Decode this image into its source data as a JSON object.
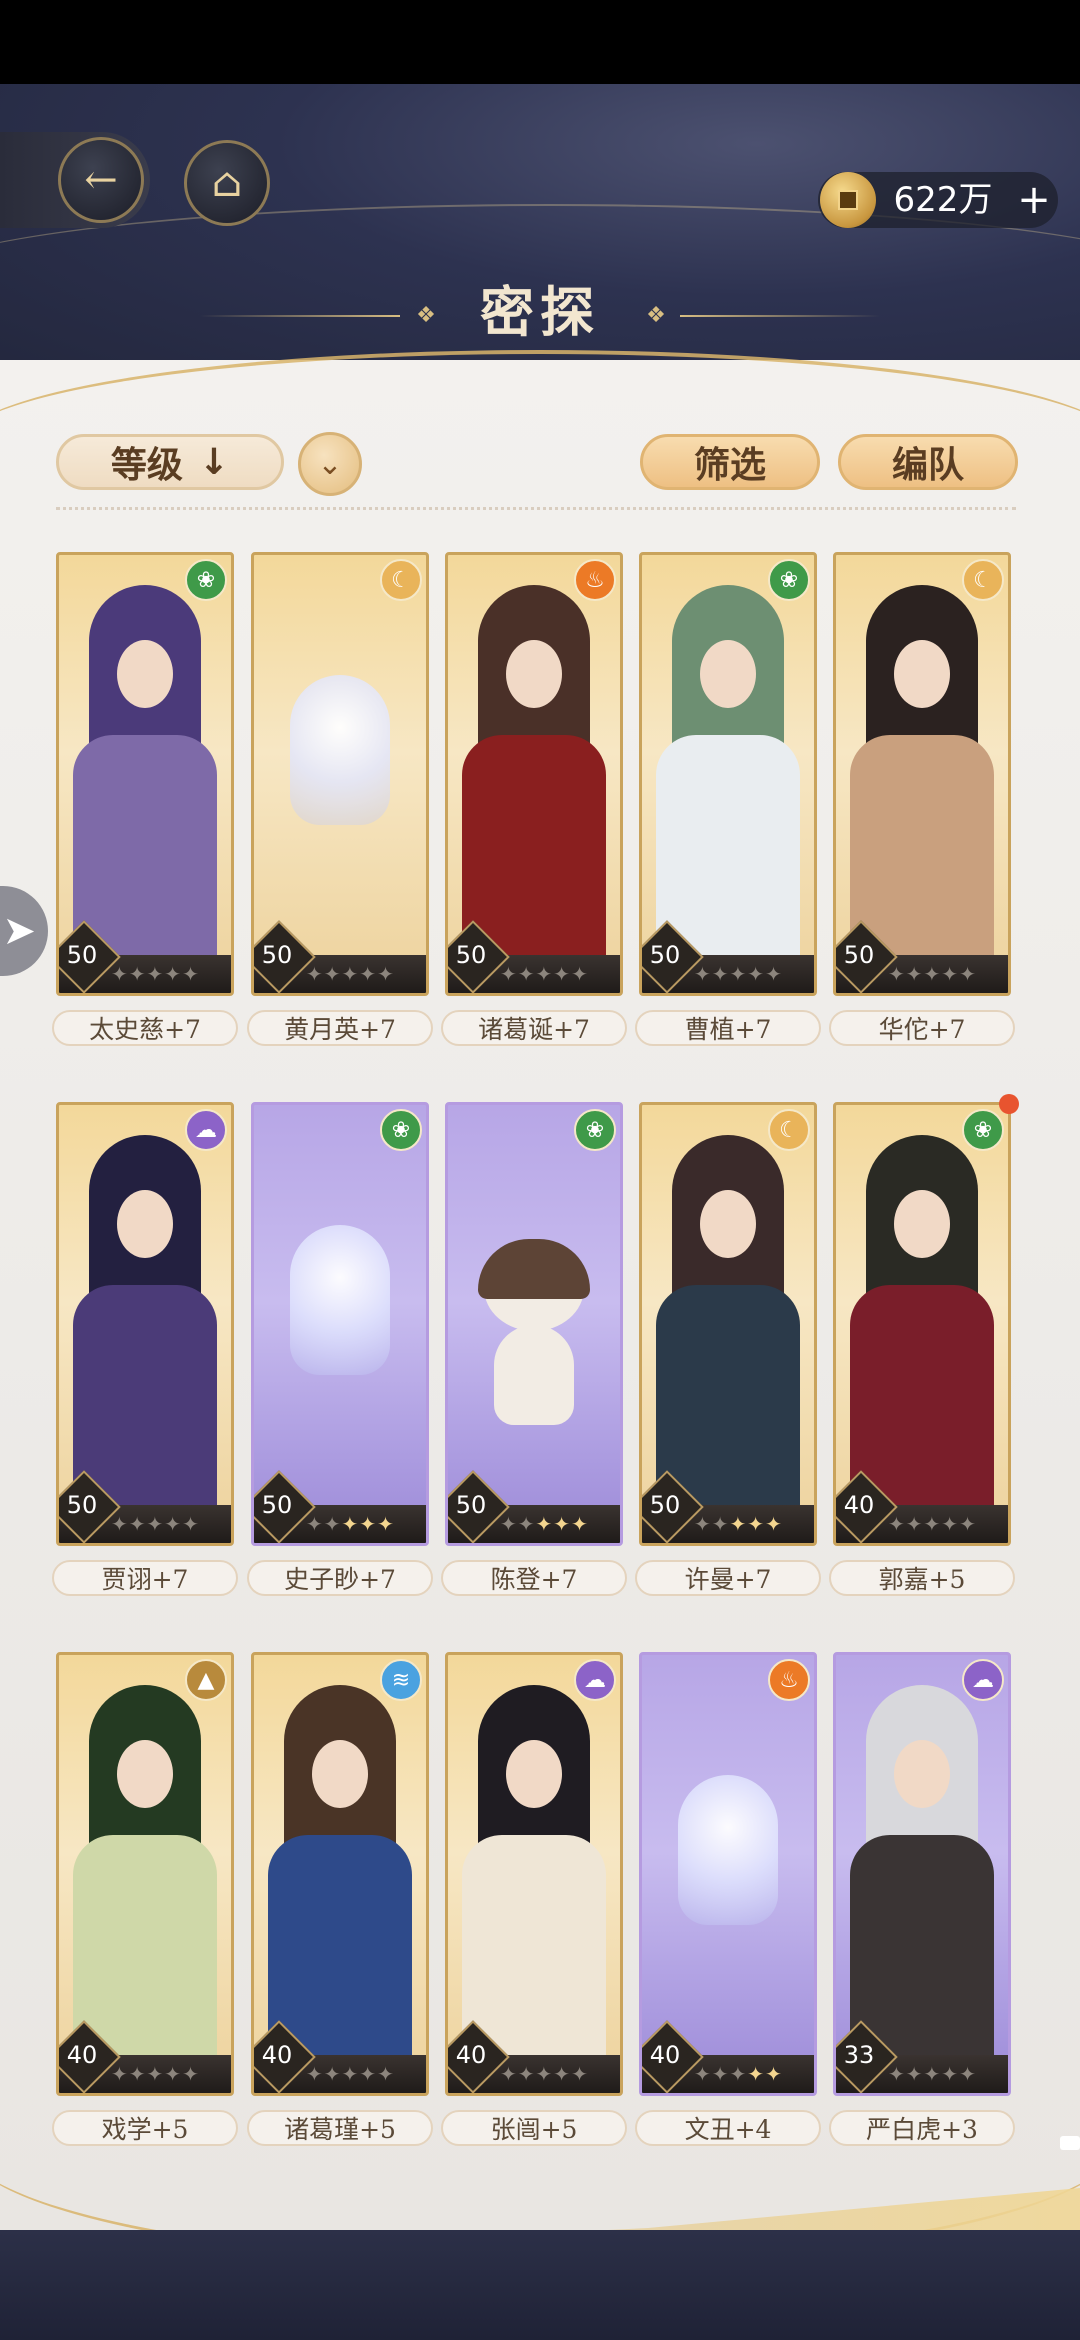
{
  "header": {
    "title": "密探",
    "currency_value": "622万",
    "currency_add": "+",
    "back_icon": "back-arrow-icon",
    "home_icon": "pavilion-icon"
  },
  "controls": {
    "sort_label": "等级",
    "sort_direction_glyph": "↓",
    "filter_label": "筛选",
    "team_label": "编队"
  },
  "colors": {
    "gold_card": "#f3d89a",
    "purple_card": "#b7a6e6",
    "accent": "#d9b46b"
  },
  "cards": [
    {
      "name": "太史慈+7",
      "level": "50",
      "stars_lit": 0,
      "element": "wind",
      "rarity": "gold",
      "art": "character",
      "hair": "#4b3a7a",
      "body": "#7e6aa8"
    },
    {
      "name": "黄月英+7",
      "level": "50",
      "stars_lit": 0,
      "element": "moon",
      "rarity": "gold",
      "art": "ghost"
    },
    {
      "name": "诸葛诞+7",
      "level": "50",
      "stars_lit": 0,
      "element": "fire",
      "rarity": "gold",
      "art": "character",
      "hair": "#4a3028",
      "body": "#8a1f1f"
    },
    {
      "name": "曹植+7",
      "level": "50",
      "stars_lit": 0,
      "element": "wind",
      "rarity": "gold",
      "art": "character",
      "hair": "#6d8f72",
      "body": "#e9edf0"
    },
    {
      "name": "华佗+7",
      "level": "50",
      "stars_lit": 0,
      "element": "moon",
      "rarity": "gold",
      "art": "character",
      "hair": "#2b2220",
      "body": "#c9a07e"
    },
    {
      "name": "贾诩+7",
      "level": "50",
      "stars_lit": 0,
      "element": "cloud",
      "rarity": "gold",
      "art": "character",
      "hair": "#232040",
      "body": "#4b3b78"
    },
    {
      "name": "史子眇+7",
      "level": "50",
      "stars_lit": 3,
      "element": "wind",
      "rarity": "purple",
      "art": "ghost"
    },
    {
      "name": "陈登+7",
      "level": "50",
      "stars_lit": 3,
      "element": "wind",
      "rarity": "purple",
      "art": "cat"
    },
    {
      "name": "许曼+7",
      "level": "50",
      "stars_lit": 3,
      "element": "moon",
      "rarity": "gold",
      "art": "character",
      "hair": "#3a2a2a",
      "body": "#2b3a4a"
    },
    {
      "name": "郭嘉+5",
      "level": "40",
      "stars_lit": 0,
      "element": "wind",
      "rarity": "gold",
      "art": "character",
      "hair": "#2a2a24",
      "body": "#7a1e2a",
      "new_dot": true
    },
    {
      "name": "戏学+5",
      "level": "40",
      "stars_lit": 0,
      "element": "mountain",
      "rarity": "gold",
      "art": "character",
      "hair": "#243a22",
      "body": "#cfd8a8"
    },
    {
      "name": "诸葛瑾+5",
      "level": "40",
      "stars_lit": 0,
      "element": "water",
      "rarity": "gold",
      "art": "character",
      "hair": "#4a3426",
      "body": "#2e4a8a"
    },
    {
      "name": "张闿+5",
      "level": "40",
      "stars_lit": 0,
      "element": "cloud",
      "rarity": "gold",
      "art": "character",
      "hair": "#1f1c22",
      "body": "#efe6d6"
    },
    {
      "name": "文丑+4",
      "level": "40",
      "stars_lit": 2,
      "element": "fire",
      "rarity": "purple",
      "art": "ghost"
    },
    {
      "name": "严白虎+3",
      "level": "33",
      "stars_lit": 0,
      "element": "cloud",
      "rarity": "purple",
      "art": "character",
      "hair": "#d8d8dc",
      "body": "#3a3434"
    }
  ]
}
